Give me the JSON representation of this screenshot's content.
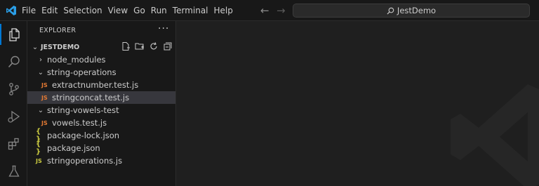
{
  "menu": [
    "File",
    "Edit",
    "Selection",
    "View",
    "Go",
    "Run",
    "Terminal",
    "Help"
  ],
  "search": {
    "text": "JestDemo"
  },
  "explorer": {
    "title": "EXPLORER",
    "more": "···",
    "root": "JESTDEMO",
    "items": [
      {
        "label": "node_modules",
        "type": "folder",
        "expanded": false
      },
      {
        "label": "string-operations",
        "type": "folder",
        "expanded": true
      },
      {
        "label": "extractnumber.test.js",
        "type": "test-js"
      },
      {
        "label": "stringconcat.test.js",
        "type": "test-js",
        "selected": true
      },
      {
        "label": "string-vowels-test",
        "type": "folder",
        "expanded": true
      },
      {
        "label": "vowels.test.js",
        "type": "test-js"
      },
      {
        "label": "package-lock.json",
        "type": "json"
      },
      {
        "label": "package.json",
        "type": "json"
      },
      {
        "label": "stringoperations.js",
        "type": "js"
      }
    ],
    "js_badge": "JS",
    "json_badge": "{ }"
  },
  "colors": {
    "accent": "#0078d4",
    "js": "#cbcb41",
    "test_js": "#e37933"
  }
}
